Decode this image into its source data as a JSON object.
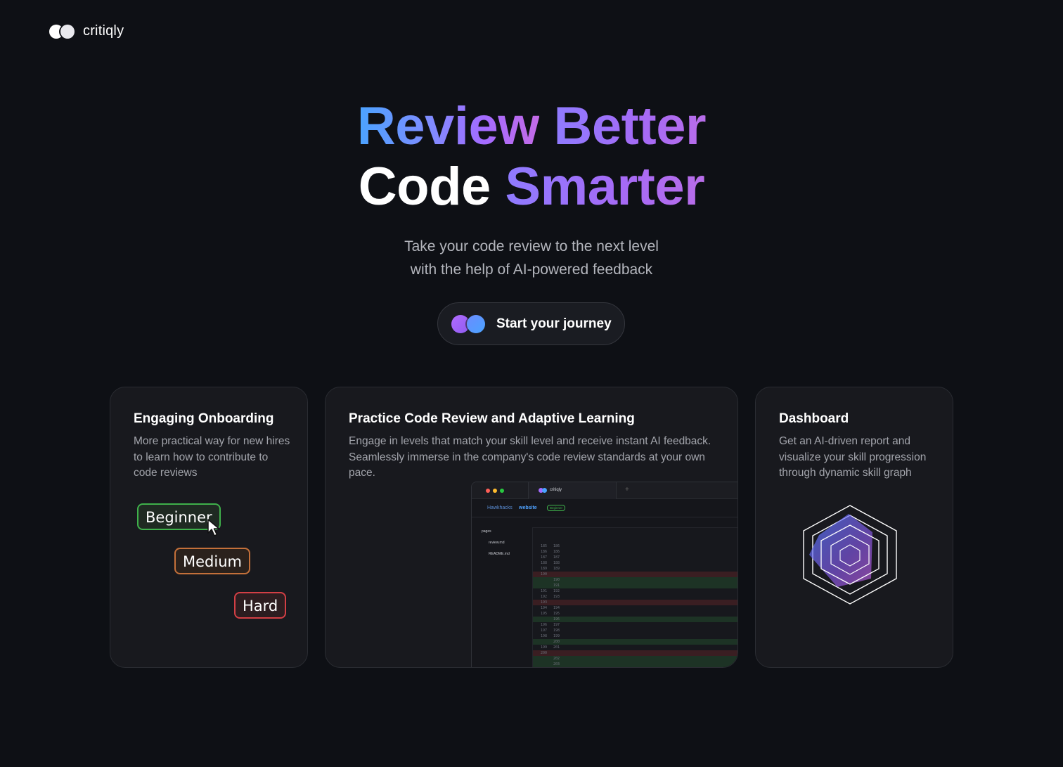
{
  "brand": {
    "name": "critiqly",
    "logo_icon": "two-circles-logo-icon"
  },
  "hero": {
    "line1_part1": "Review",
    "line1_part2": "Better",
    "line2_part1": "Code",
    "line2_part2": "Smarter",
    "subtitle_line1": "Take your code review to the next level",
    "subtitle_line2": "with the help of AI-powered feedback",
    "cta_label": "Start your journey"
  },
  "cards": [
    {
      "title": "Engaging Onboarding",
      "description": "More practical way for new hires to learn how to contribute to code reviews",
      "levels": [
        "Beginner",
        "Medium",
        "Hard"
      ]
    },
    {
      "title": "Practice Code Review and Adaptive Learning",
      "description": "Engage in levels that match your skill level and receive instant AI feedback. Seamlessly immerse in the company's code review standards at your own pace.",
      "editor": {
        "tab_label": "critiqly",
        "crumb_org": "Hawkhacks",
        "crumb_repo": "website",
        "crumb_badge": "Beginner",
        "files": [
          "pages",
          "review.md",
          "README.md"
        ]
      }
    },
    {
      "title": "Dashboard",
      "description": " Get an AI-driven report and visualize your skill progression through dynamic skill graph"
    }
  ],
  "colors": {
    "background": "#0e1015",
    "card_bg": "#18191e",
    "beginner": "#3fb14b",
    "medium": "#c4703a",
    "hard": "#d33f45"
  }
}
